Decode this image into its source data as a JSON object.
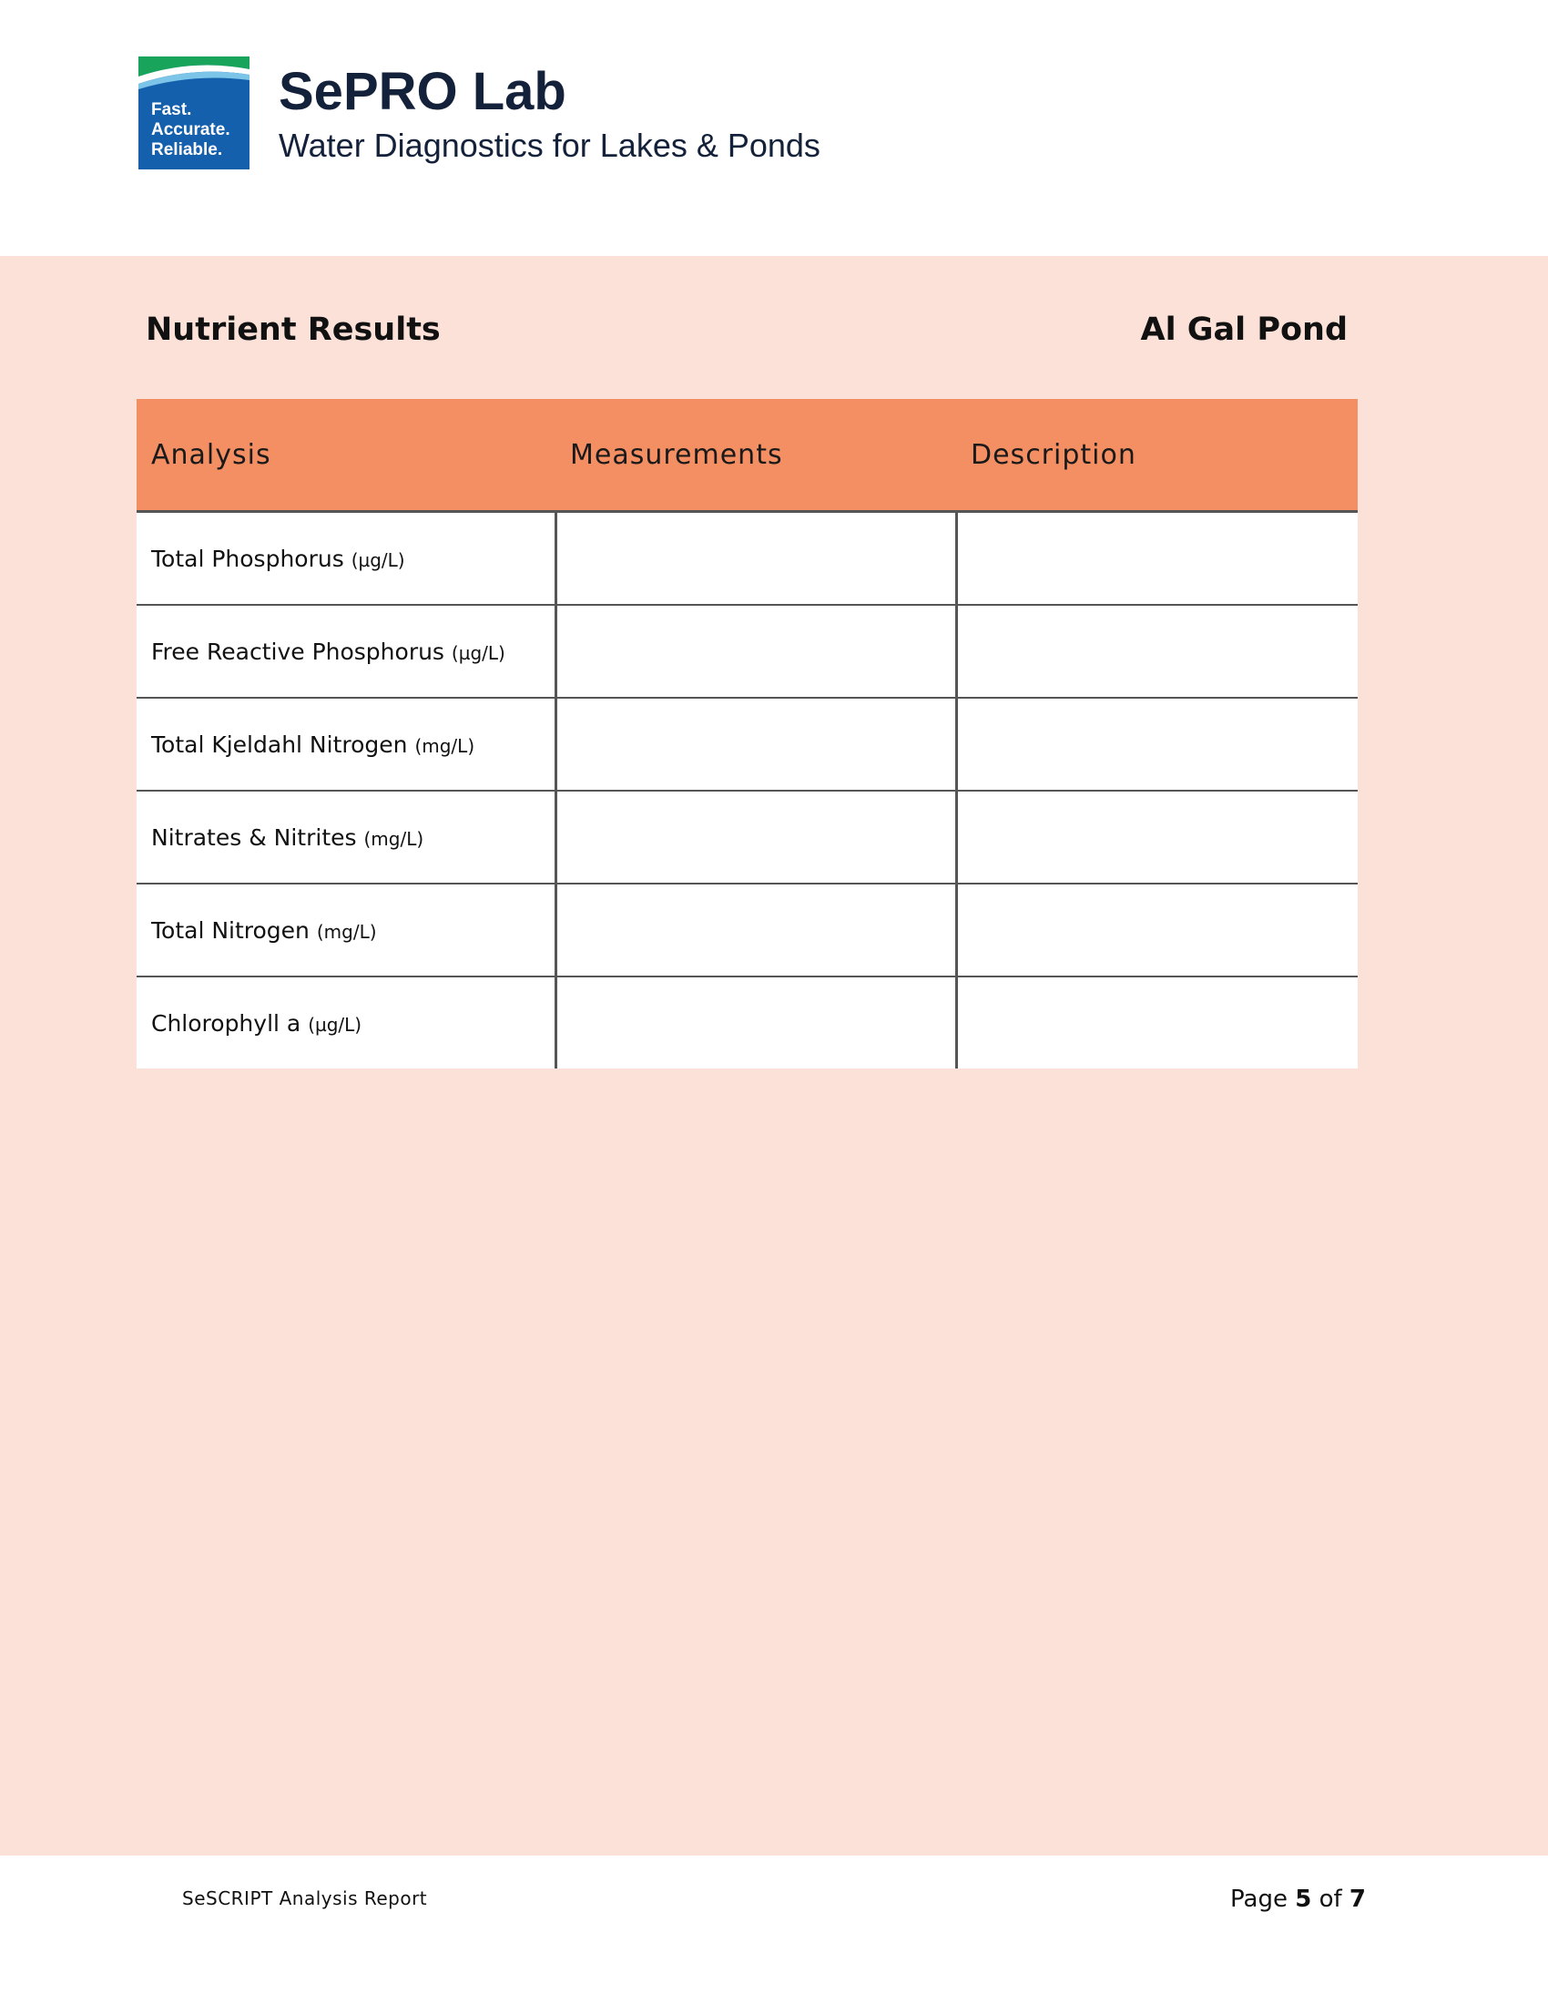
{
  "header": {
    "logo_lines": [
      "Fast.",
      "Accurate.",
      "Reliable."
    ],
    "brand_title": "SePRO Lab",
    "brand_subtitle": "Water Diagnostics for Lakes & Ponds",
    "colors": {
      "logo_blue": "#1460ad",
      "logo_green": "#18a45a"
    }
  },
  "section": {
    "title": "Nutrient Results",
    "site": "Al Gal Pond"
  },
  "table": {
    "columns": [
      "Analysis",
      "Measurements",
      "Description"
    ],
    "rows": [
      {
        "analysis": "Total Phosphorus",
        "unit": "(µg/L)",
        "measurement": "",
        "description": ""
      },
      {
        "analysis": "Free Reactive Phosphorus",
        "unit": "(µg/L)",
        "measurement": "",
        "description": ""
      },
      {
        "analysis": "Total Kjeldahl Nitrogen",
        "unit": "(mg/L)",
        "measurement": "",
        "description": ""
      },
      {
        "analysis": "Nitrates & Nitrites",
        "unit": "(mg/L)",
        "measurement": "",
        "description": ""
      },
      {
        "analysis": "Total Nitrogen",
        "unit": "(mg/L)",
        "measurement": "",
        "description": ""
      },
      {
        "analysis": "Chlorophyll a",
        "unit": "(µg/L)",
        "measurement": "",
        "description": ""
      }
    ],
    "colors": {
      "header_bg": "#f48f63",
      "band_bg": "#fbe1d7"
    }
  },
  "footer": {
    "report_name": "SeSCRIPT Analysis Report",
    "page_prefix": "Page",
    "page_current": "5",
    "page_of": "of",
    "page_total": "7"
  }
}
